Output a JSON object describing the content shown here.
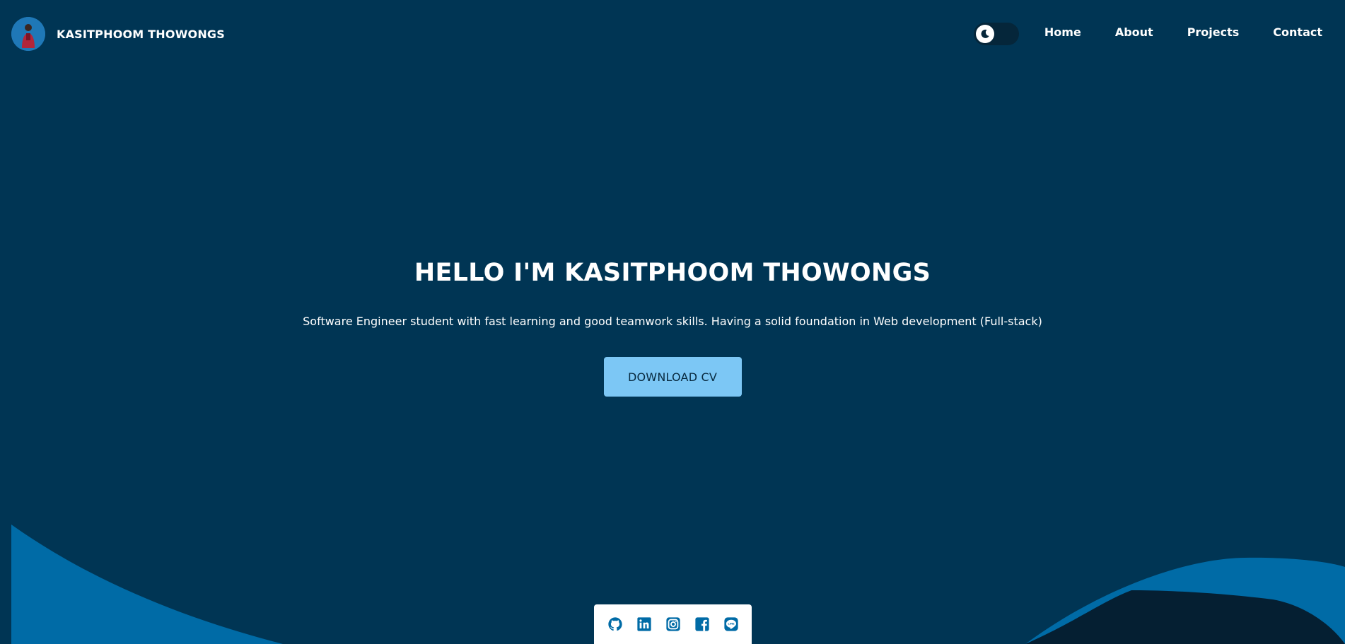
{
  "header": {
    "brand_name": "KASITPHOOM THOWONGS",
    "nav": [
      "Home",
      "About",
      "Projects",
      "Contact"
    ]
  },
  "hero": {
    "title": "HELLO I'M KASITPHOOM THOWONGS",
    "subtitle": "Software Engineer student with fast learning and good teamwork skills. Having a solid foundation in Web development (Full-stack)",
    "cta_label": "DOWNLOAD CV"
  },
  "social": {
    "icons": [
      "github-icon",
      "linkedin-icon",
      "instagram-icon",
      "facebook-icon",
      "line-icon"
    ]
  },
  "theme": {
    "mode": "dark",
    "background": "#003554",
    "wave_color": "#006ba6",
    "dark_wave_color": "#051f32",
    "button_color": "#7cc7f5",
    "icon_color": "#006ba6"
  }
}
